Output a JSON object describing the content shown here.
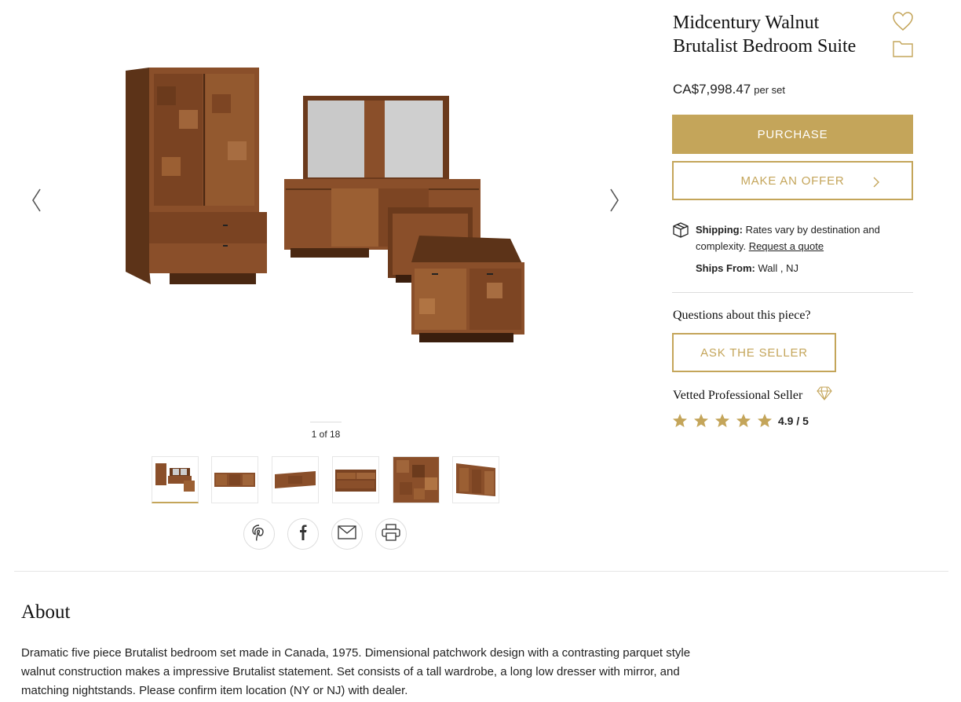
{
  "product": {
    "title": "Midcentury Walnut Brutalist Bedroom Suite",
    "price": "CA$7,998.47",
    "price_unit": "per set"
  },
  "actions": {
    "purchase_label": "PURCHASE",
    "offer_label": "MAKE AN OFFER",
    "ask_label": "ASK THE SELLER"
  },
  "shipping": {
    "label": "Shipping:",
    "text": "Rates vary by destination and complexity.",
    "link": "Request a quote",
    "from_label": "Ships From:",
    "from_value": "Wall , NJ"
  },
  "questions_label": "Questions about this piece?",
  "seller": {
    "badge_text": "Vetted Professional Seller",
    "rating": "4.9 / 5",
    "stars": 5
  },
  "gallery": {
    "counter": "1 of 18",
    "thumbnails": [
      "suite",
      "dresser-front",
      "dresser-angle",
      "dresser-open",
      "wardrobe-detail",
      "dresser-side"
    ],
    "active_index": 0
  },
  "share": [
    "pinterest-icon",
    "facebook-icon",
    "email-icon",
    "print-icon"
  ],
  "about": {
    "heading": "About",
    "body": "Dramatic five piece Brutalist bedroom set made in Canada, 1975. Dimensional patchwork design with a contrasting parquet style walnut construction makes a impressive Brutalist statement. Set consists of a tall wardrobe, a long low dresser with mirror, and matching nightstands. Please confirm item location (NY or NJ) with dealer."
  },
  "colors": {
    "accent": "#c4a55a",
    "wood": "#8a4f2a",
    "wood_dark": "#5c3318"
  }
}
